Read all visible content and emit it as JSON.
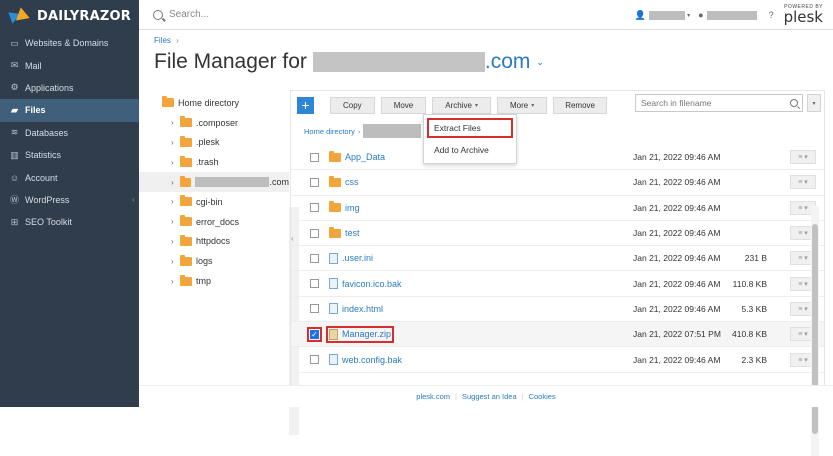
{
  "brand": {
    "name": "DAILYRAZOR",
    "plesk_powered": "POWERED BY",
    "plesk": "plesk"
  },
  "sidebar": {
    "items": [
      {
        "label": "Websites & Domains",
        "icon": "monitor-icon"
      },
      {
        "label": "Mail",
        "icon": "mail-icon"
      },
      {
        "label": "Applications",
        "icon": "gear-icon"
      },
      {
        "label": "Files",
        "icon": "folder-icon",
        "active": true
      },
      {
        "label": "Databases",
        "icon": "database-icon"
      },
      {
        "label": "Statistics",
        "icon": "bar-chart-icon"
      },
      {
        "label": "Account",
        "icon": "user-icon"
      },
      {
        "label": "WordPress",
        "icon": "wordpress-icon"
      },
      {
        "label": "SEO Toolkit",
        "icon": "seo-icon"
      }
    ]
  },
  "topbar": {
    "search_placeholder": "Search..."
  },
  "breadcrumb": {
    "root": "Files",
    "sep": "›"
  },
  "page": {
    "title_prefix": "File Manager for",
    "title_suffix": ".com"
  },
  "tree": {
    "root": "Home directory",
    "items": [
      ".composer",
      ".plesk",
      ".trash",
      ".com",
      "cgi-bin",
      "error_docs",
      "httpdocs",
      "logs",
      "tmp"
    ]
  },
  "toolbar": {
    "add": "+",
    "copy": "Copy",
    "move": "Move",
    "archive": "Archive",
    "more": "More",
    "remove": "Remove",
    "search_placeholder": "Search in filename"
  },
  "path": {
    "root": "Home directory",
    "sep": "›"
  },
  "archive_menu": {
    "extract": "Extract Files",
    "add": "Add to Archive"
  },
  "files": [
    {
      "name": "App_Data",
      "type": "folder",
      "date": "Jan 21, 2022 09:46 AM",
      "size": ""
    },
    {
      "name": "css",
      "type": "folder",
      "date": "Jan 21, 2022 09:46 AM",
      "size": ""
    },
    {
      "name": "img",
      "type": "folder",
      "date": "Jan 21, 2022 09:46 AM",
      "size": ""
    },
    {
      "name": "test",
      "type": "folder",
      "date": "Jan 21, 2022 09:46 AM",
      "size": ""
    },
    {
      "name": ".user.ini",
      "type": "file",
      "date": "Jan 21, 2022 09:46 AM",
      "size": "231 B"
    },
    {
      "name": "favicon.ico.bak",
      "type": "file",
      "date": "Jan 21, 2022 09:46 AM",
      "size": "110.8 KB"
    },
    {
      "name": "index.html",
      "type": "file",
      "date": "Jan 21, 2022 09:46 AM",
      "size": "5.3 KB"
    },
    {
      "name": "Manager.zip",
      "type": "zip",
      "date": "Jan 21, 2022 07:51 PM",
      "size": "410.8 KB",
      "checked": true
    },
    {
      "name": "web.config.bak",
      "type": "file",
      "date": "Jan 21, 2022 09:46 AM",
      "size": "2.3 KB"
    }
  ],
  "footer": {
    "link1": "plesk.com",
    "link2": "Suggest an Idea",
    "link3": "Cookies"
  }
}
